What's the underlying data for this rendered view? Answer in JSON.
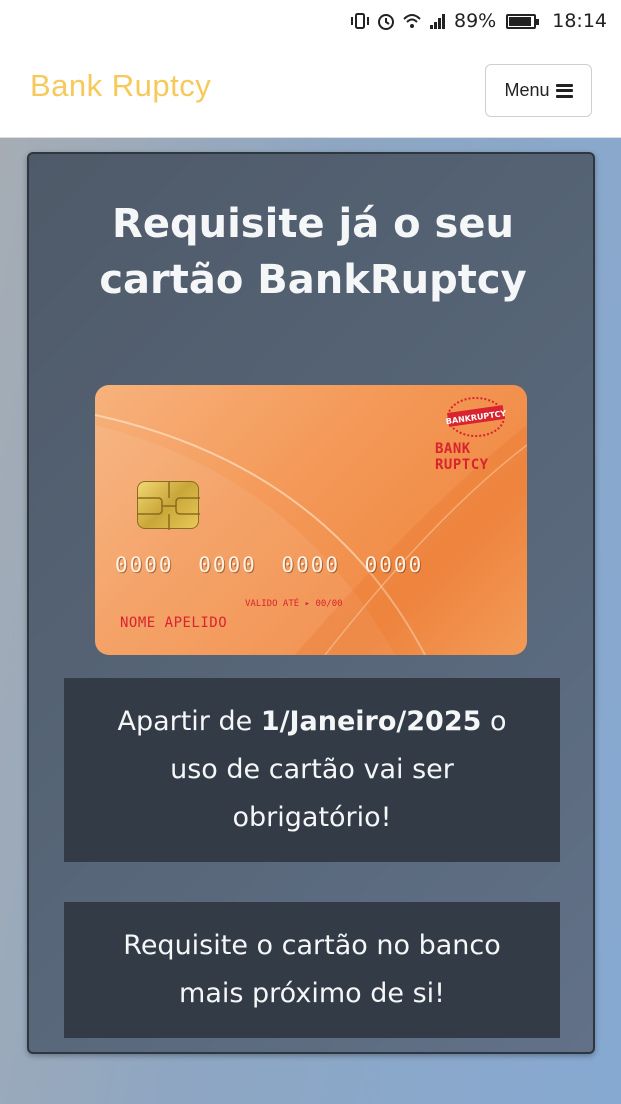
{
  "status_bar": {
    "battery": "89%",
    "time": "18:14"
  },
  "navbar": {
    "brand": "Bank Ruptcy",
    "menu_label": "Menu"
  },
  "panel": {
    "title": "Requisite já o seu cartão BankRuptcy"
  },
  "card": {
    "stamp_text": "BANKRUPTCY",
    "brand": "BANK RUPTCY",
    "number": "0000 0000 0000 0000",
    "valid_label": "VALIDO ATÉ ▸ 00/00",
    "holder": "NOME  APELIDO"
  },
  "notice": {
    "prefix": "Apartir de ",
    "date": "1/Janeiro/2025",
    "suffix": " o uso de cartão vai ser obrigatório!"
  },
  "cta": {
    "text": "Requisite o cartão no banco mais próximo de si!"
  },
  "colors": {
    "brand": "#f6c95a",
    "card_accent": "#d9242f",
    "panel": "#566577",
    "box": "#333c46"
  }
}
